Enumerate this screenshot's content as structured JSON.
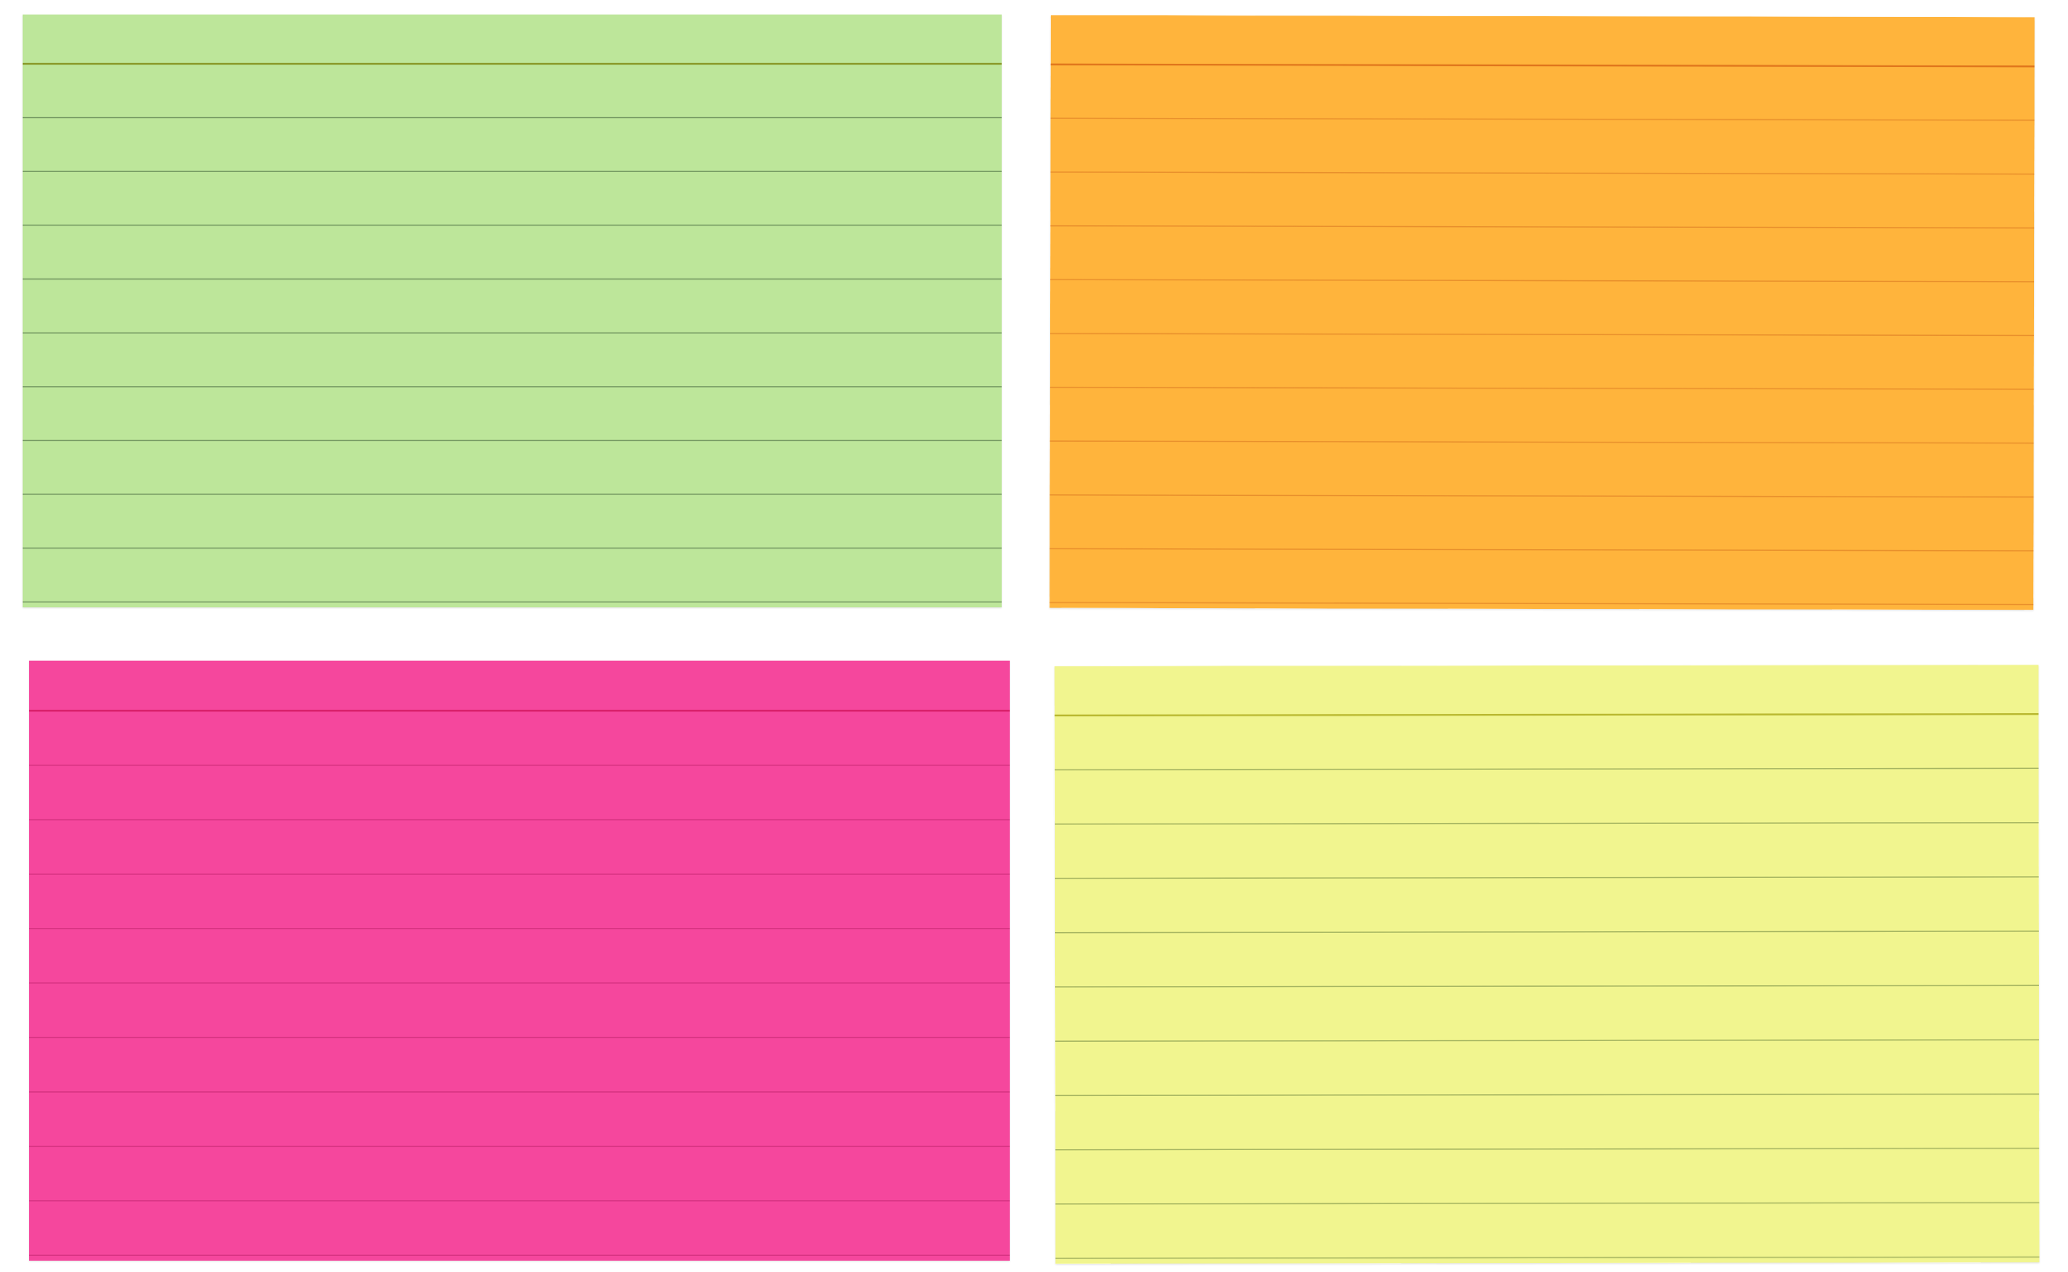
{
  "cards": [
    {
      "id": "green",
      "fill": "#bde69a",
      "header_line_color": "#8a9a2a",
      "rule_color": "#6a8d5a",
      "ruled_lines": 10
    },
    {
      "id": "orange",
      "fill": "#ffb43c",
      "header_line_color": "#e0761c",
      "rule_color": "#e58a2a",
      "ruled_lines": 10
    },
    {
      "id": "pink",
      "fill": "#f5479d",
      "header_line_color": "#d9206b",
      "rule_color": "#d2307e",
      "ruled_lines": 10
    },
    {
      "id": "yellow",
      "fill": "#f1f58f",
      "header_line_color": "#b9b830",
      "rule_color": "#9aaa5a",
      "ruled_lines": 10
    }
  ]
}
